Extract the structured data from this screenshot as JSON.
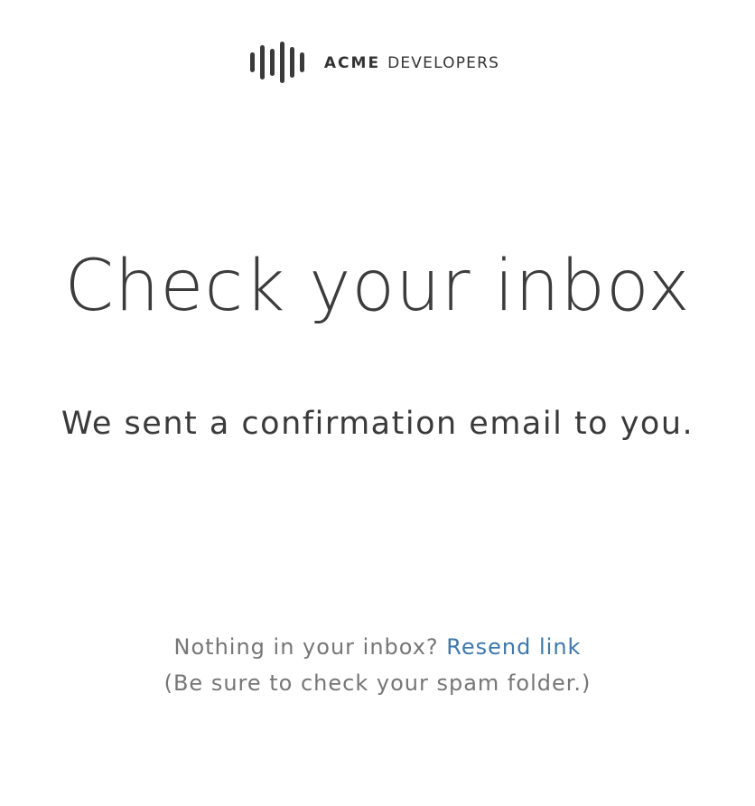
{
  "brand": {
    "name_strong": "ACME",
    "name_light": "DEVELOPERS",
    "logo_icon": "equalizer-bars-icon",
    "logo_color": "#3a3a3a"
  },
  "main": {
    "headline": "Check your inbox",
    "message": "We sent a confirmation email to you."
  },
  "footer": {
    "prompt": "Nothing in your inbox?",
    "resend_label": "Resend link",
    "spam_hint": "(Be sure to check your spam folder.)",
    "link_color": "#3c78ae",
    "text_color": "#767676"
  }
}
